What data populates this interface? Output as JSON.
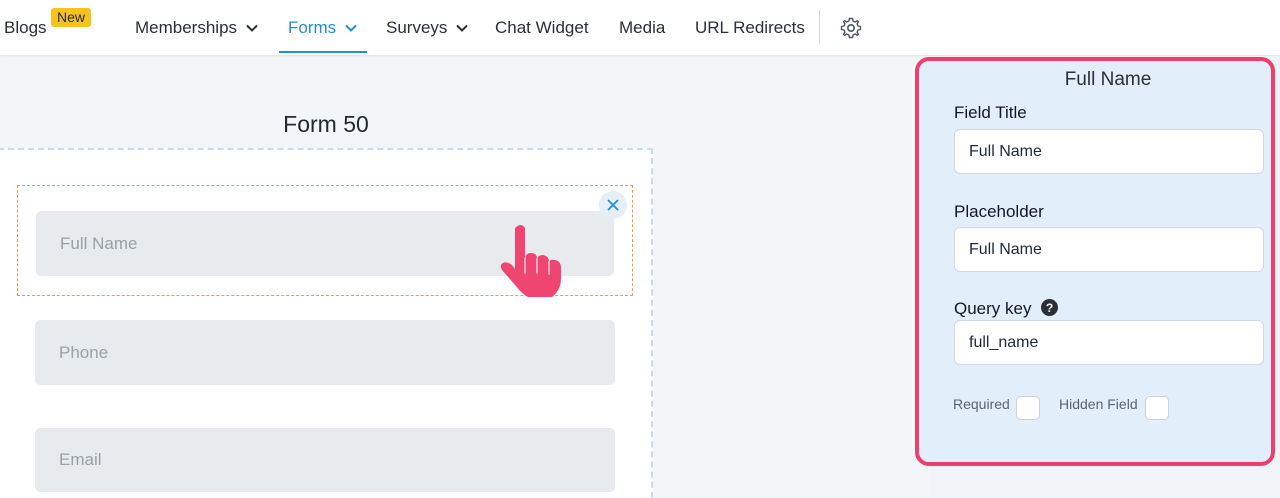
{
  "nav": {
    "items": [
      {
        "label": "Blogs"
      },
      {
        "label": "Memberships"
      },
      {
        "label": "Forms"
      },
      {
        "label": "Surveys"
      },
      {
        "label": "Chat Widget"
      },
      {
        "label": "Media"
      },
      {
        "label": "URL Redirects"
      }
    ],
    "badge": "New",
    "active": "Forms",
    "accent_color": "#1f8fd6",
    "badge_color": "#f7c21d"
  },
  "form": {
    "title": "Form 50",
    "fields": [
      {
        "placeholder": "Full Name"
      },
      {
        "placeholder": "Phone"
      },
      {
        "placeholder": "Email"
      }
    ],
    "selection_color": "#f39a4a"
  },
  "panel": {
    "title": "Full Name",
    "field_title_label": "Field Title",
    "field_title_value": "Full Name",
    "placeholder_label": "Placeholder",
    "placeholder_value": "Full Name",
    "query_key_label": "Query key",
    "query_key_value": "full_name",
    "required_label": "Required",
    "hidden_label": "Hidden Field",
    "required_checked": false,
    "hidden_checked": false,
    "highlight_color": "#ef3e6d",
    "help_icon": "question-circle-icon"
  }
}
